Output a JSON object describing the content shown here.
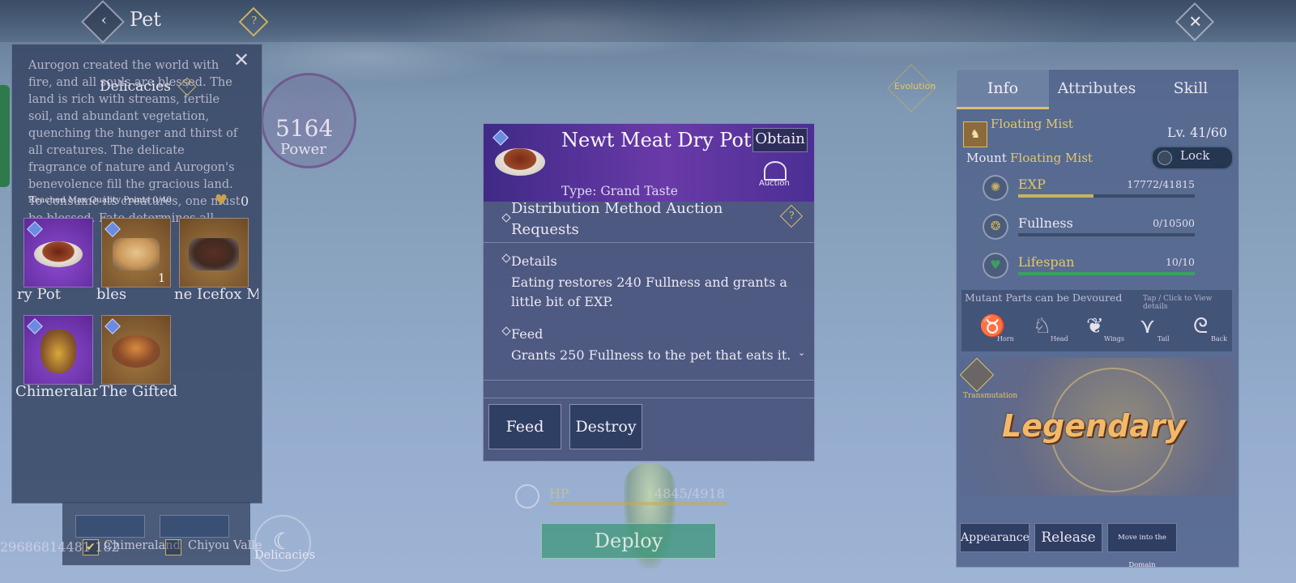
{
  "header": {
    "back_icon": "back-arrow-icon",
    "title": "Pet",
    "help_glyph": "?",
    "close_glyph": "✕"
  },
  "left_panel": {
    "lore": "Aurogon created the world with fire, and all souls are blessed. The land is rich with streams, fertile soil, and abundant vegetation, quenching the hunger and thirst of all creatures. The delicate fragrance of nature and Aurogon's benevolence fill the gracious land. To consume its creatures, one must be blessed. Fate determines all.",
    "close_glyph": "✕",
    "title": "Delicacies",
    "help_glyph": "?",
    "max_quality_text": "Reached Max Quality Points 0/40",
    "heart_glyph": "♥",
    "quality_points": "0",
    "items": [
      {
        "label": "ry Pot",
        "rarity": "purple",
        "count": ""
      },
      {
        "label": "bles",
        "rarity": "orange",
        "count": "1"
      },
      {
        "label": "ne Icefox M",
        "rarity": "orange",
        "count": ""
      },
      {
        "label": "Chimeralar",
        "rarity": "purple",
        "count": ""
      },
      {
        "label": "The Gifted",
        "rarity": "orange",
        "count": ""
      }
    ]
  },
  "under_tray": {
    "check_glyph": "✔",
    "region_1": "Chimeraland",
    "region_2": "Chiyou Valle",
    "code": "29686814481 182"
  },
  "power": {
    "value": "5164",
    "label": "Power"
  },
  "evolution_label": "Evolution",
  "delicacies_button": {
    "label": "Delicacies",
    "icon": "delicacies-icon",
    "glyph": "☾"
  },
  "item_dialog": {
    "title": "Newt Meat Dry Pot",
    "obtain_label": "Obtain",
    "auction_label": "Auction",
    "type": "Type: Grand Taste",
    "distribution": "Distribution Method    Auction Requests",
    "help_glyph": "?",
    "details_header": "Details",
    "details_body": "Eating restores 240 Fullness and grants a little bit of EXP.",
    "feed_header": "Feed",
    "feed_body": "Grants 250 Fullness to the pet that eats it.",
    "scroll_glyph": "⌄",
    "feed_button": "Feed",
    "destroy_button": "Destroy"
  },
  "hp": {
    "label": "HP",
    "value": "4845/4918"
  },
  "deploy_label": "Deploy",
  "right_panel": {
    "tabs": [
      "Info",
      "Attributes",
      "Skill"
    ],
    "active_tab": "Info",
    "pet_badge_glyph": "♞",
    "pet_name": "Floating Mist",
    "level": "Lv. 41/60",
    "mount_label": "Mount",
    "mount_name": "Floating Mist",
    "lock_label": "Lock",
    "stats": [
      {
        "label": "EXP",
        "value": "17772/41815",
        "fraction": 0.425,
        "color": "#c9b260",
        "label_color": "#e3c86a",
        "icon": "exp-icon",
        "glyph": "✺"
      },
      {
        "label": "Fullness",
        "value": "0/10500",
        "fraction": 0,
        "color": "#c9b260",
        "label_color": "#ece8f4",
        "icon": "fullness-icon",
        "glyph": "❂"
      },
      {
        "label": "Lifespan",
        "value": "10/10",
        "fraction": 1,
        "color": "#3aa060",
        "label_color": "#e3c86a",
        "icon": "heart-icon",
        "glyph": "♥"
      }
    ],
    "mutant_title": "Mutant Parts can be Devoured",
    "mutant_hint": "Tap / Click to View details",
    "parts": [
      {
        "label": "Horn",
        "icon": "horn-icon",
        "glyph": "♉"
      },
      {
        "label": "Head",
        "icon": "head-icon",
        "glyph": "♘"
      },
      {
        "label": "Wings",
        "icon": "wings-icon",
        "glyph": "❦"
      },
      {
        "label": "Tail",
        "icon": "tail-icon",
        "glyph": "⋎"
      },
      {
        "label": "Back",
        "icon": "back-icon",
        "glyph": "ᘓ"
      }
    ],
    "rarity_text": "Legendary",
    "transmutation_label": "Transmutation",
    "transmutation_glyph": "✦",
    "buttons": {
      "appearance": "Appearance",
      "release": "Release",
      "domain": "Move into the Domain"
    }
  }
}
